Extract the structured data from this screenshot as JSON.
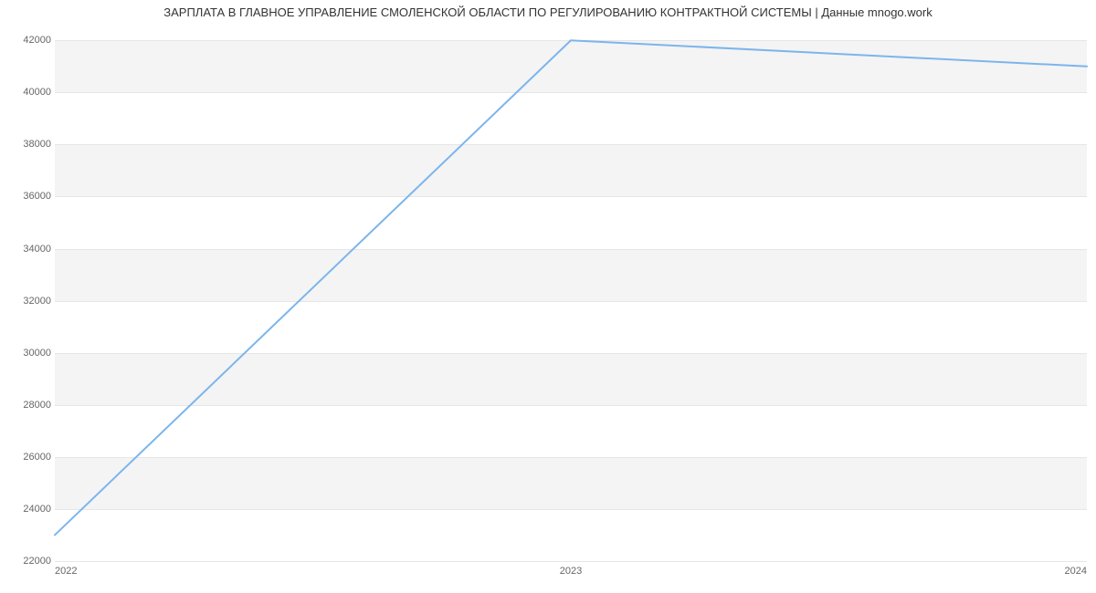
{
  "chart_data": {
    "type": "line",
    "title": "ЗАРПЛАТА В ГЛАВНОЕ УПРАВЛЕНИЕ СМОЛЕНСКОЙ ОБЛАСТИ ПО РЕГУЛИРОВАНИЮ КОНТРАКТНОЙ СИСТЕМЫ | Данные mnogo.work",
    "xlabel": "",
    "ylabel": "",
    "y_ticks": [
      22000,
      24000,
      26000,
      28000,
      30000,
      32000,
      34000,
      36000,
      38000,
      40000,
      42000
    ],
    "x_ticks": [
      "2022",
      "2023",
      "2024"
    ],
    "x": [
      2022,
      2023,
      2024
    ],
    "values": [
      23000,
      42000,
      41000
    ],
    "ylim": [
      22000,
      42500
    ],
    "line_color": "#7cb5ec"
  }
}
